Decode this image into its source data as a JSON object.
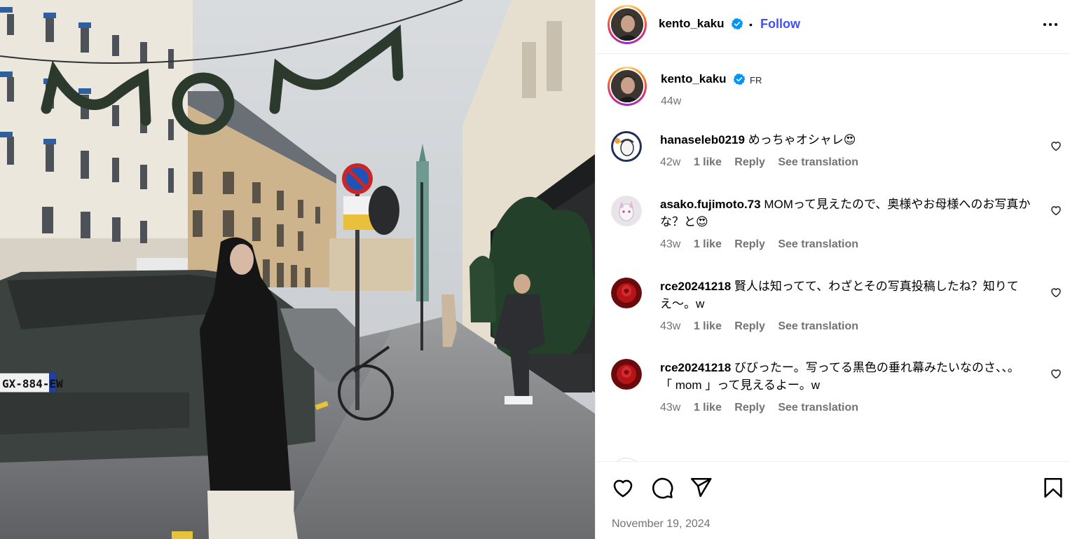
{
  "post": {
    "author": "kento_kaku",
    "follow_label": "Follow",
    "separator": "•",
    "more_icon": "more-horizontal-icon",
    "location": "FR",
    "age": "44w",
    "date": "November 19, 2024"
  },
  "photo": {
    "garland_text": "MOM",
    "plate": "GX-884-EW"
  },
  "comments": [
    {
      "user": "hanaseleb0219",
      "text": "めっちゃオシャレ😍",
      "time": "42w",
      "likes": "1 like",
      "reply": "Reply",
      "translate": "See translation"
    },
    {
      "user": "asako.fujimoto.73",
      "text": "MOMって見えたので、奥様やお母様へのお写真かな？と😍",
      "time": "43w",
      "likes": "1 like",
      "reply": "Reply",
      "translate": "See translation"
    },
    {
      "user": "rce20241218",
      "text": "賢人は知ってて、わざとその写真投稿したね？知りてえ〜。w",
      "time": "43w",
      "likes": "1 like",
      "reply": "Reply",
      "translate": "See translation"
    },
    {
      "user": "rce20241218",
      "text": "びびったー。写ってる黒色の垂れ幕みたいなのさ、、。",
      "text2": "「 mom 」って見えるよー。w",
      "time": "43w",
      "likes": "1 like",
      "reply": "Reply",
      "translate": "See translation"
    }
  ],
  "colors": {
    "follow": "#4150f7",
    "verified": "#0095f6",
    "muted": "#737373"
  },
  "icons": [
    "heart-icon",
    "comment-icon",
    "share-icon",
    "bookmark-icon",
    "verified-icon"
  ]
}
